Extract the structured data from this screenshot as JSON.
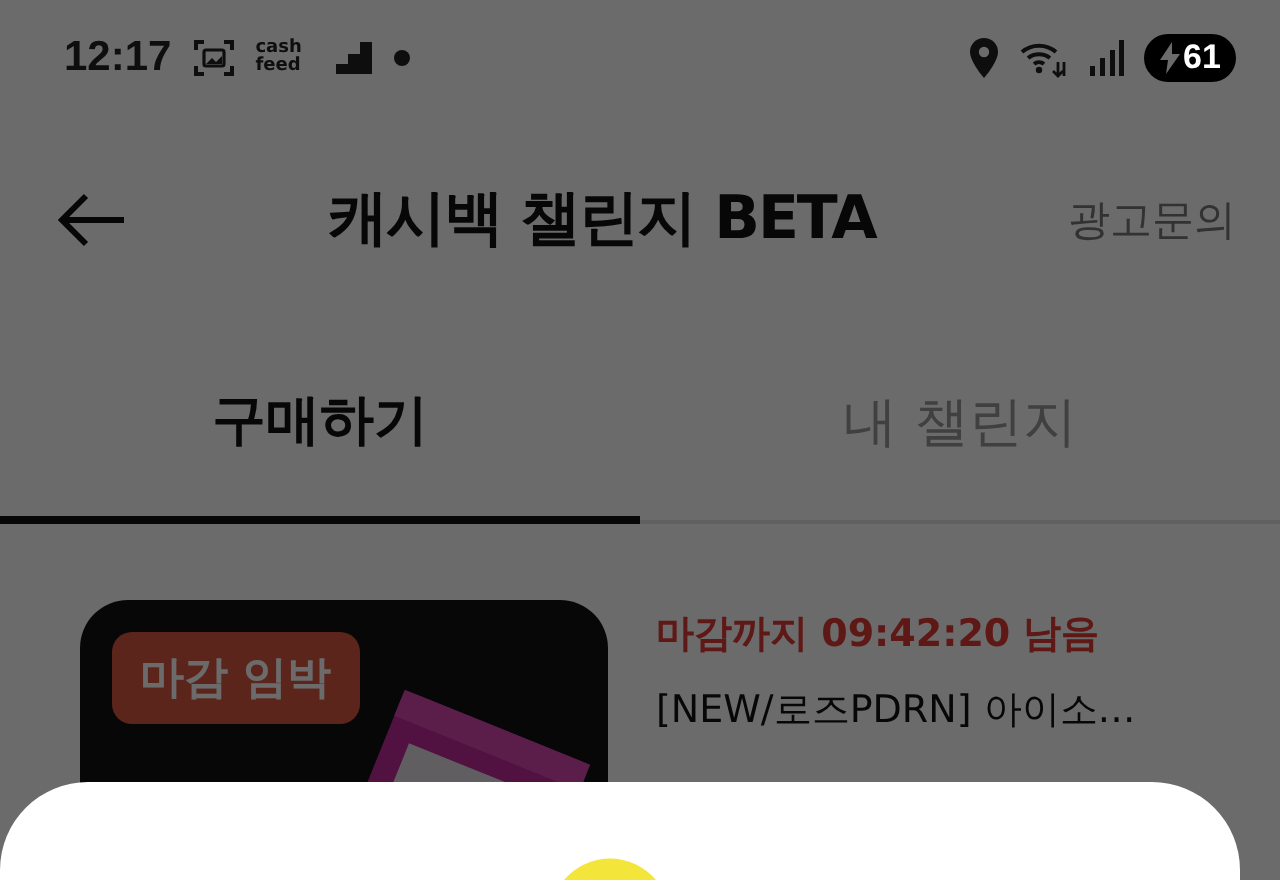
{
  "status_bar": {
    "time": "12:17",
    "app_badge": "cash feed",
    "battery": "61"
  },
  "header": {
    "title": "캐시백 챌린지 BETA",
    "action": "광고문의"
  },
  "tabs": [
    {
      "label": "구매하기",
      "selected": true
    },
    {
      "label": "내 챌린지",
      "selected": false
    }
  ],
  "items": [
    {
      "badge": "마감 임박",
      "countdown": "마감까지 09:42:20 남음",
      "title": "[NEW/로즈PDRN] 아이소…"
    }
  ]
}
